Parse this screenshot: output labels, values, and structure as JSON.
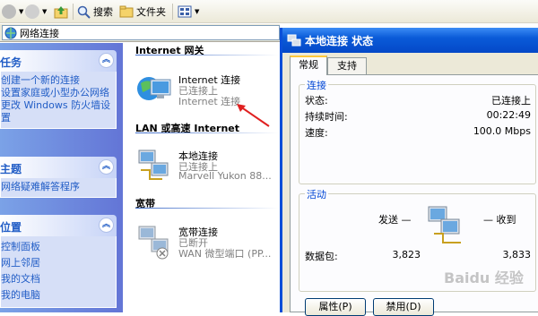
{
  "toolbar": {
    "search_label": "搜索",
    "folders_label": "文件夹"
  },
  "address": {
    "value": "网络连接"
  },
  "tasks": {
    "network_tasks": {
      "title": "任务",
      "items": [
        "创建一个新的连接",
        "设置家庭或小型办公网络",
        "更改 Windows 防火墙设置"
      ]
    },
    "see_also": {
      "title": "主题",
      "items": [
        "网络疑难解答程序"
      ]
    },
    "other_places": {
      "title": "位置",
      "items": [
        "控制面板",
        "网上邻居",
        "我的文档",
        "我的电脑"
      ]
    }
  },
  "groups": {
    "internet_gateway": "Internet 网关",
    "lan": "LAN 或高速 Internet",
    "broadband": "宽带"
  },
  "connections": [
    {
      "name": "Internet 连接",
      "status": "已连接上",
      "device": "Internet 连接"
    },
    {
      "name": "本地连接",
      "status": "已连接上",
      "device": "Marvell Yukon 88..."
    },
    {
      "name": "宽带连接",
      "status": "已断开",
      "device": "WAN 微型端口 (PP..."
    }
  ],
  "dialog": {
    "title": "本地连接 状态",
    "tabs": [
      "常规",
      "支持"
    ],
    "connection_section": "连接",
    "status_label": "状态:",
    "status_value": "已连接上",
    "duration_label": "持续时间:",
    "duration_value": "00:22:49",
    "speed_label": "速度:",
    "speed_value": "100.0 Mbps",
    "activity_section": "活动",
    "sent_label": "发送 —",
    "received_label": "— 收到",
    "packets_label": "数据包:",
    "packets_sent": "3,823",
    "packets_received": "3,833",
    "properties_button": "属性(P)",
    "disable_button": "禁用(D)"
  },
  "watermark": "Baidu 经验"
}
